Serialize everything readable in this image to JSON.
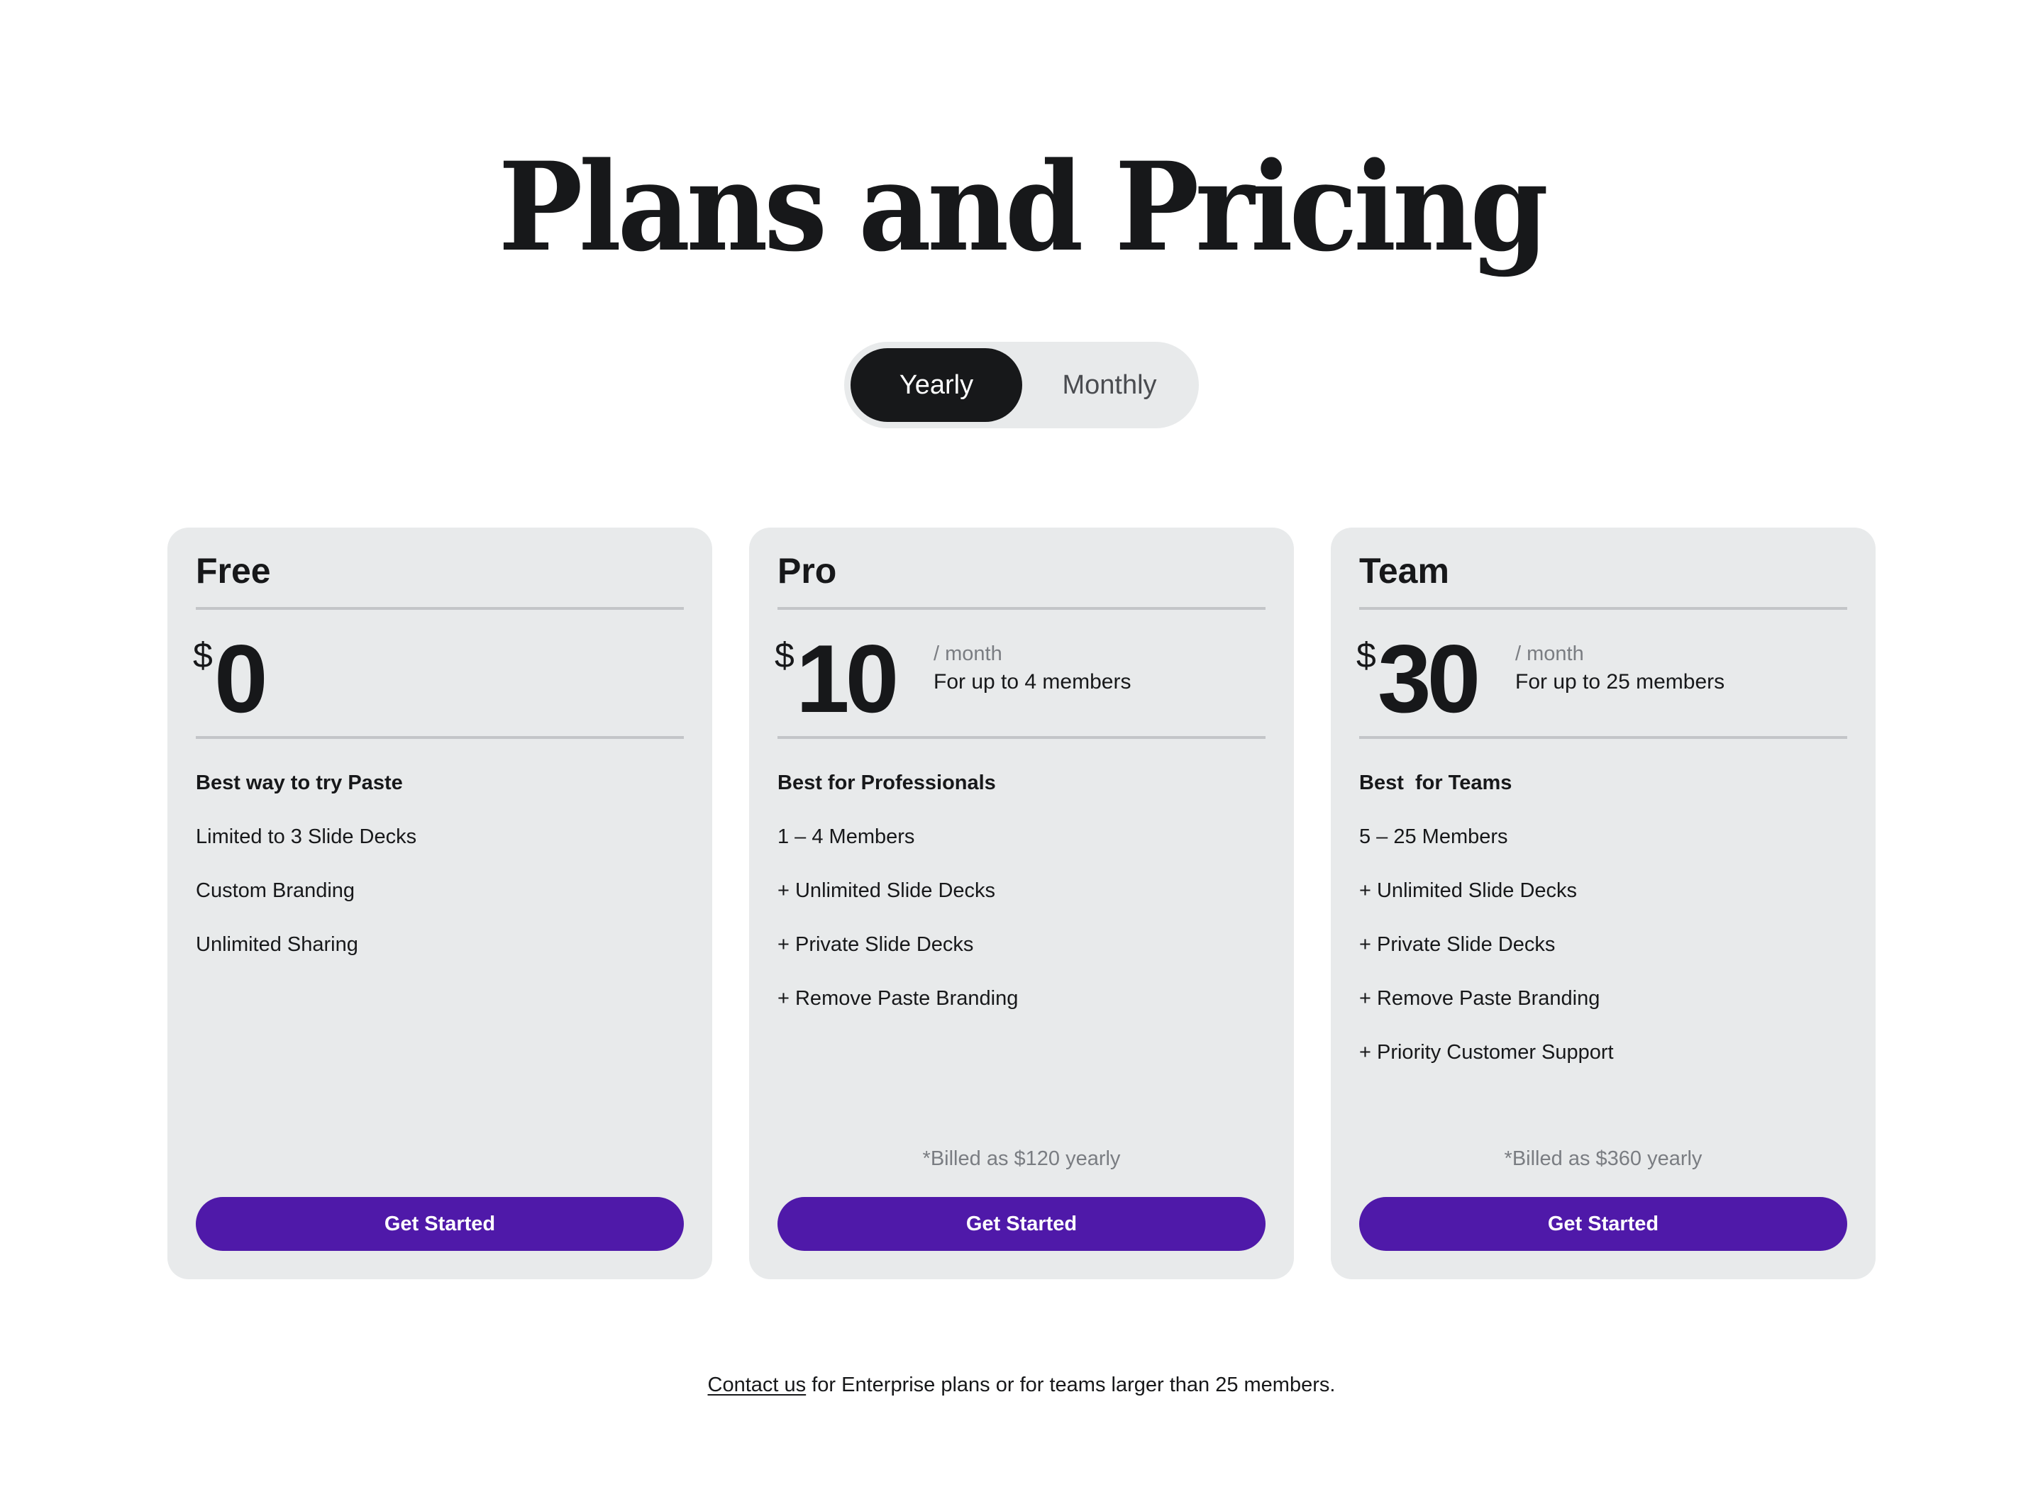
{
  "header": {
    "title": "Plans and Pricing"
  },
  "billing_toggle": {
    "options": [
      {
        "label": "Yearly",
        "selected": true
      },
      {
        "label": "Monthly",
        "selected": false
      }
    ]
  },
  "plans": [
    {
      "name": "Free",
      "currency": "$",
      "amount": "0",
      "period": "",
      "member_cap": "",
      "headline": "Best way to try Paste",
      "features": [
        "Limited to 3 Slide Decks",
        "Custom Branding",
        "Unlimited Sharing"
      ],
      "billed_note": "",
      "cta_label": "Get Started"
    },
    {
      "name": "Pro",
      "currency": "$",
      "amount": "10",
      "period": "/ month",
      "member_cap": "For up to 4 members",
      "headline": "Best for Professionals",
      "features": [
        "1 – 4 Members",
        "+ Unlimited Slide Decks",
        "+ Private Slide Decks",
        "+ Remove Paste Branding"
      ],
      "billed_note": "*Billed as $120 yearly",
      "cta_label": "Get Started"
    },
    {
      "name": "Team",
      "currency": "$",
      "amount": "30",
      "period": "/ month",
      "member_cap": "For up to 25 members",
      "headline": "Best  for Teams",
      "features": [
        "5 – 25 Members",
        "+ Unlimited Slide Decks",
        "+ Private Slide Decks",
        "+ Remove Paste Branding",
        "+ Priority Customer Support"
      ],
      "billed_note": "*Billed as $360 yearly",
      "cta_label": "Get Started"
    }
  ],
  "footer": {
    "contact_link": "Contact us",
    "note": " for Enterprise plans or for teams larger than 25 members."
  },
  "colors": {
    "accent": "#4f19a9",
    "card_background": "#e8eaeb",
    "text": "#17181a",
    "muted_text": "#7a7d82"
  }
}
